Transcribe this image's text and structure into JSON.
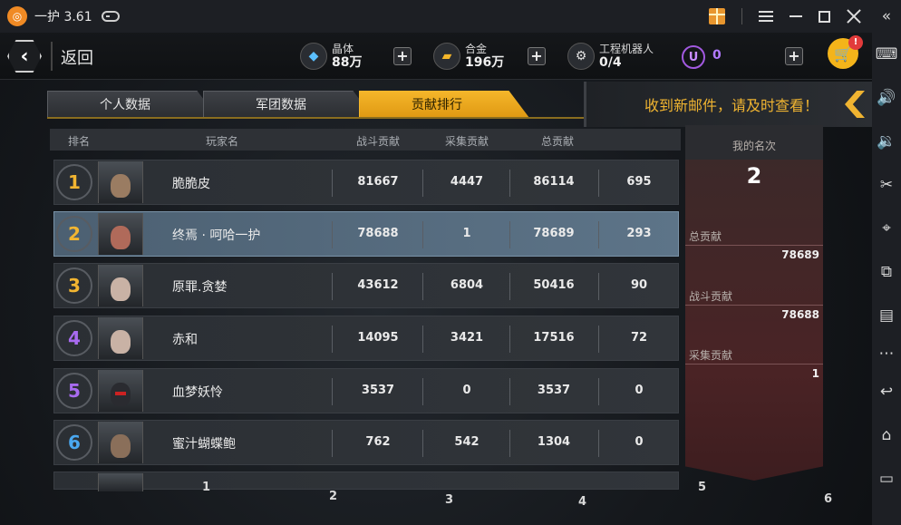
{
  "window": {
    "title": "一护 3.61"
  },
  "header": {
    "back_label": "返回",
    "resources": [
      {
        "label": "晶体",
        "value": "88万",
        "icon": "crystal-icon"
      },
      {
        "label": "合金",
        "value": "196万",
        "icon": "alloy-icon"
      },
      {
        "label": "工程机器人",
        "value": "0/4",
        "icon": "robot-icon"
      }
    ],
    "currency_symbol": "U",
    "currency_value": "0",
    "cart_badge": "!"
  },
  "tabs": [
    {
      "label": "个人数据",
      "active": false
    },
    {
      "label": "军团数据",
      "active": false
    },
    {
      "label": "贡献排行",
      "active": true
    }
  ],
  "notice": "收到新邮件，请及时查看！",
  "table": {
    "headers": {
      "rank": "排名",
      "player": "玩家名",
      "battle": "战斗贡献",
      "gather": "采集贡献",
      "total": "总贡献"
    },
    "rows": [
      {
        "rank": "1",
        "name": "脆脆皮",
        "battle": "81667",
        "gather": "4447",
        "total": "86114",
        "extra": "695"
      },
      {
        "rank": "2",
        "name": "终焉 · 呵哈一护",
        "battle": "78688",
        "gather": "1",
        "total": "78689",
        "extra": "293"
      },
      {
        "rank": "3",
        "name": "原罪.贪婪",
        "battle": "43612",
        "gather": "6804",
        "total": "50416",
        "extra": "90"
      },
      {
        "rank": "4",
        "name": "赤和",
        "battle": "14095",
        "gather": "3421",
        "total": "17516",
        "extra": "72"
      },
      {
        "rank": "5",
        "name": "血梦妖怜",
        "battle": "3537",
        "gather": "0",
        "total": "3537",
        "extra": "0"
      },
      {
        "rank": "6",
        "name": "蜜汁蝴蝶鲍",
        "battle": "762",
        "gather": "542",
        "total": "1304",
        "extra": "0"
      }
    ]
  },
  "my_rank": {
    "title": "我的名次",
    "rank": "2",
    "total_label": "总贡献",
    "total_value": "78689",
    "battle_label": "战斗贡献",
    "battle_value": "78688",
    "gather_label": "采集贡献",
    "gather_value": "1"
  },
  "column_numbers": [
    "1",
    "2",
    "3",
    "4",
    "5",
    "6"
  ],
  "colors": {
    "gold": "#f4b62a",
    "rank1": "#f2b531",
    "rank2": "#f2b531",
    "rank3": "#f2b531",
    "rank4": "#a86bf0",
    "rank5": "#a86bf0",
    "rank6": "#4aa8f0"
  }
}
